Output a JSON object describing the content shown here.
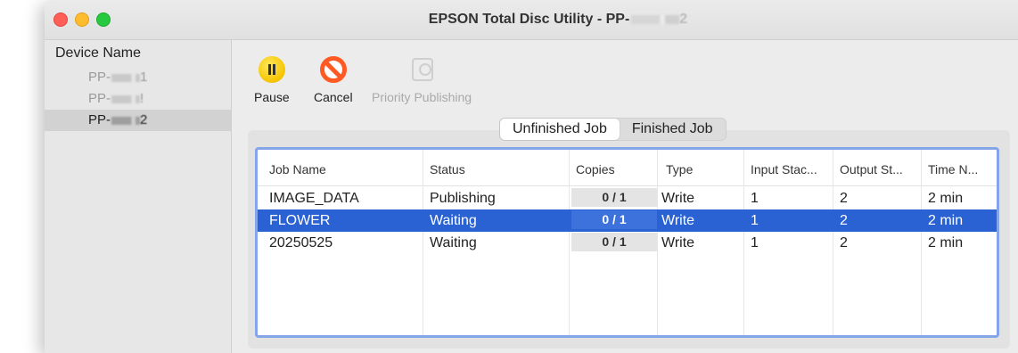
{
  "window": {
    "title_prefix": "EPSON Total Disc Utility - PP-",
    "title_suffix": "2"
  },
  "sidebar": {
    "header": "Device Name",
    "devices": [
      {
        "prefix": "PP-",
        "suffix": "1",
        "selected": false
      },
      {
        "prefix": "PP-",
        "suffix": "!",
        "selected": false
      },
      {
        "prefix": "PP-",
        "suffix": "2",
        "selected": true
      }
    ]
  },
  "toolbar": {
    "pause_label": "Pause",
    "cancel_label": "Cancel",
    "priority_label": "Priority Publishing"
  },
  "tabs": [
    {
      "label": "Unfinished Job",
      "active": true
    },
    {
      "label": "Finished Job",
      "active": false
    }
  ],
  "table": {
    "columns": [
      "Job Name",
      "Status",
      "Copies",
      "Type",
      "Input Stac...",
      "Output St...",
      "Time N..."
    ],
    "rows": [
      {
        "job_name": "IMAGE_DATA",
        "status": "Publishing",
        "copies": "0 / 1",
        "type": "Write",
        "input_stacker": "1",
        "output_stacker": "2",
        "time": "2 min",
        "selected": false
      },
      {
        "job_name": "FLOWER",
        "status": "Waiting",
        "copies": "0 / 1",
        "type": "Write",
        "input_stacker": "1",
        "output_stacker": "2",
        "time": "2 min",
        "selected": true
      },
      {
        "job_name": "20250525",
        "status": "Waiting",
        "copies": "0 / 1",
        "type": "Write",
        "input_stacker": "1",
        "output_stacker": "2",
        "time": "2 min",
        "selected": false
      }
    ]
  },
  "colors": {
    "selection": "#2a62d3",
    "table_border": "#84a6e8"
  }
}
